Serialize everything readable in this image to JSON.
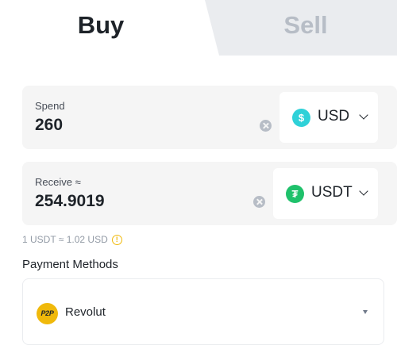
{
  "tabs": {
    "buy_label": "Buy",
    "sell_label": "Sell",
    "active": "buy"
  },
  "spend": {
    "label": "Spend",
    "value": "260",
    "currency": "USD",
    "currency_icon": "dollar-coin-icon",
    "currency_glyph": "$"
  },
  "receive": {
    "label": "Receive ≈",
    "value": "254.9019",
    "currency": "USDT",
    "currency_icon": "tether-coin-icon",
    "currency_glyph": "₮"
  },
  "rate": {
    "text": "1 USDT ≈ 1.02 USD",
    "info_glyph": "!"
  },
  "payment": {
    "label": "Payment Methods",
    "method_name": "Revolut",
    "method_icon_text": "P2P"
  },
  "colors": {
    "accent": "#f0b90b",
    "usd_coin": "#2fd1d8",
    "usdt_coin": "#1fc16b",
    "field_bg": "#f5f5f5",
    "inactive_tab": "#eaecef"
  }
}
